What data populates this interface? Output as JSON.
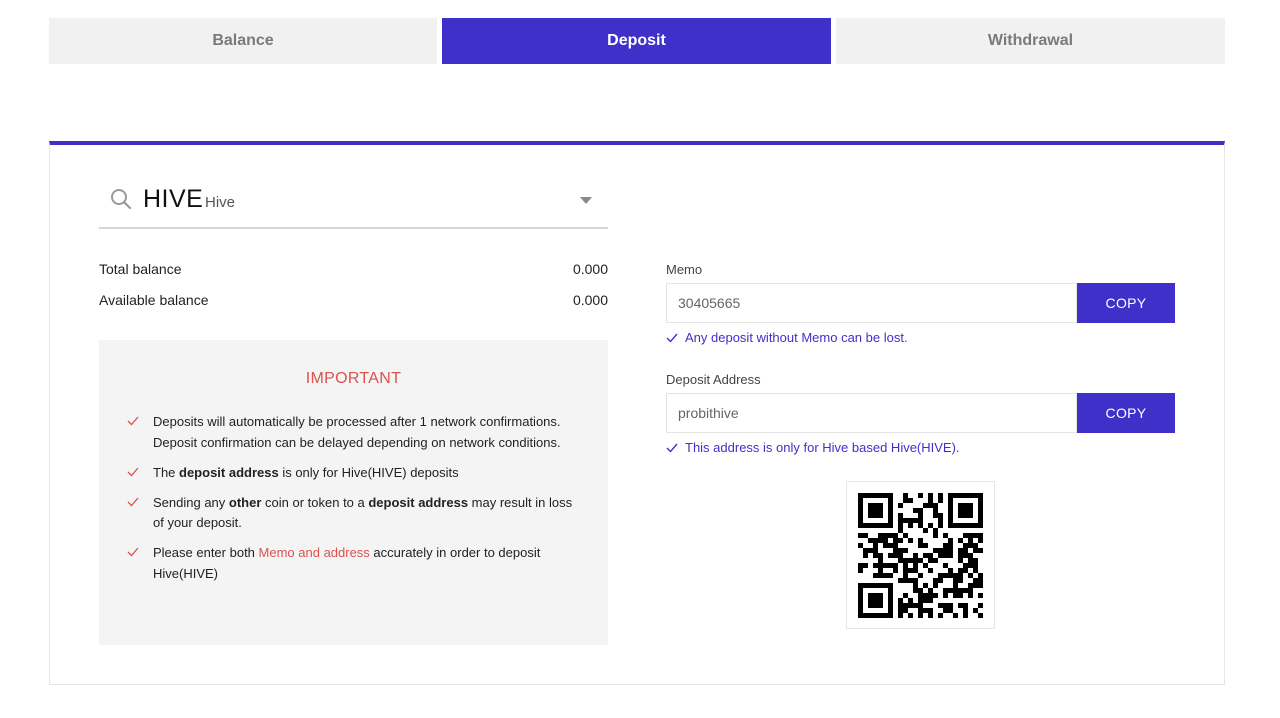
{
  "tabs": [
    {
      "label": "Balance",
      "active": false
    },
    {
      "label": "Deposit",
      "active": true
    },
    {
      "label": "Withdrawal",
      "active": false
    }
  ],
  "coin": {
    "symbol": "HIVE",
    "name": "Hive",
    "search_icon": "search-icon",
    "dropdown_icon": "chevron-down-icon"
  },
  "balances": {
    "total_label": "Total balance",
    "total_value": "0.000",
    "available_label": "Available balance",
    "available_value": "0.000"
  },
  "important": {
    "title": "IMPORTANT",
    "note1": "Deposits will automatically be processed after 1 network confirmations. Deposit confirmation can be delayed depending on network conditions.",
    "note2": {
      "pre": "The ",
      "bold": "deposit address",
      "post": " is only for Hive(HIVE) deposits"
    },
    "note3": {
      "pre": "Sending any ",
      "bold1": "other",
      "mid": " coin or token to a ",
      "bold2": "deposit address",
      "post": " may result in loss of your deposit."
    },
    "note4": {
      "pre": "Please enter both ",
      "highlight": "Memo and address",
      "post": " accurately in order to deposit Hive(HIVE)"
    }
  },
  "memo": {
    "label": "Memo",
    "value": "30405665",
    "copy_label": "COPY",
    "hint": "Any deposit without Memo can be lost."
  },
  "deposit_address": {
    "label": "Deposit Address",
    "value": "probithive",
    "copy_label": "COPY",
    "hint": "This address is only for Hive based Hive(HIVE)."
  },
  "colors": {
    "accent": "#3f30c9",
    "warning": "#d9534f",
    "tab_inactive_bg": "#f1f1f1",
    "note_bg": "#f4f4f4"
  }
}
